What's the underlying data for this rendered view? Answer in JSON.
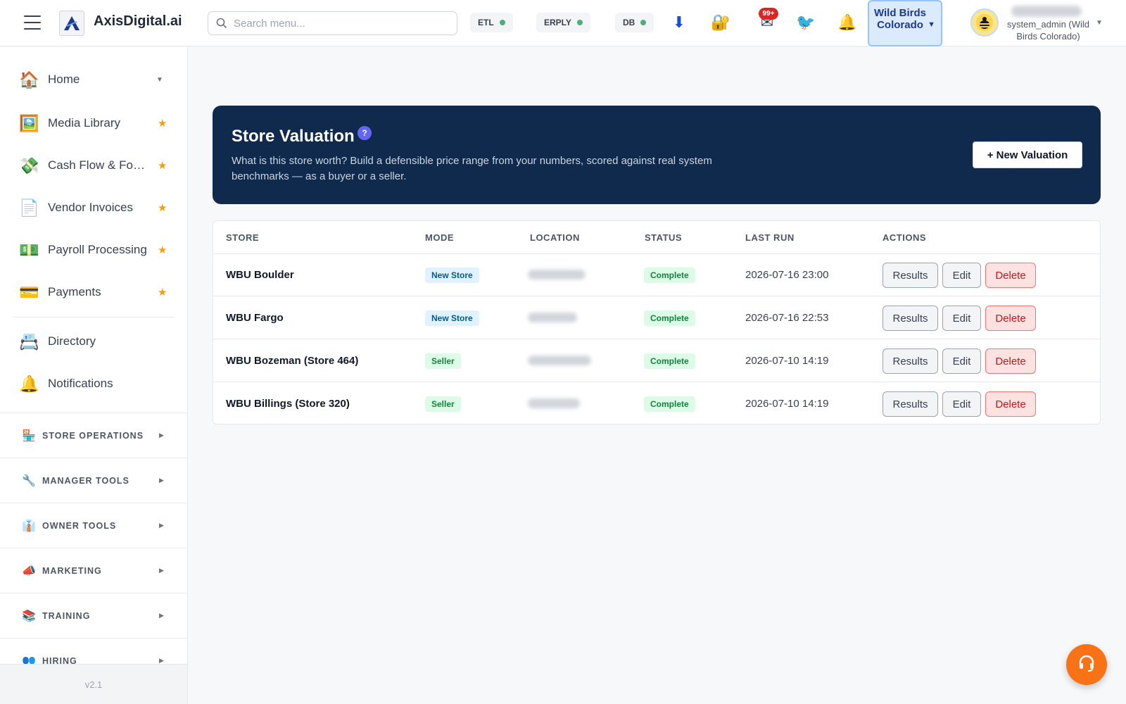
{
  "header": {
    "brand": "AxisDigital.ai",
    "search_placeholder": "Search menu...",
    "status_pills": [
      {
        "label": "ETL",
        "status_color": "#4caf7a"
      },
      {
        "label": "ERPLY",
        "status_color": "#4caf7a"
      },
      {
        "label": "DB",
        "status_color": "#4caf7a"
      }
    ],
    "icons": {
      "download": "⬇",
      "lock": "🔐",
      "mail": "✉",
      "bird": "🐦",
      "bell": "🔔"
    },
    "mail_badge": "99+",
    "store_switcher": {
      "label": "Wild Birds Colorado"
    },
    "user": {
      "role": "system_admin (Wild Birds Colorado)"
    }
  },
  "sidebar": {
    "items": [
      {
        "icon": "🏠",
        "label": "Home"
      },
      {
        "icon": "🖼️",
        "label": "Media Library"
      },
      {
        "icon": "💸",
        "label": "Cash Flow & Forecast"
      },
      {
        "icon": "📄",
        "label": "Vendor Invoices"
      },
      {
        "icon": "💵",
        "label": "Payroll Processing"
      },
      {
        "icon": "💳",
        "label": "Payments"
      },
      {
        "icon": "📇",
        "label": "Directory"
      },
      {
        "icon": "🔔",
        "label": "Notifications"
      }
    ],
    "sections": [
      {
        "icon": "🏪",
        "label": "STORE OPERATIONS"
      },
      {
        "icon": "🔧",
        "label": "MANAGER TOOLS"
      },
      {
        "icon": "👔",
        "label": "OWNER TOOLS"
      },
      {
        "icon": "📣",
        "label": "MARKETING"
      },
      {
        "icon": "📚",
        "label": "TRAINING"
      },
      {
        "icon": "👥",
        "label": "HIRING"
      }
    ],
    "version": "v2.1"
  },
  "hero": {
    "title": "Store Valuation",
    "help": "?",
    "description": "What is this store worth? Build a defensible price range from your numbers, scored against real system benchmarks — as a buyer or a seller.",
    "new_button": "+ New Valuation"
  },
  "table": {
    "columns": [
      "STORE",
      "MODE",
      "LOCATION",
      "STATUS",
      "LAST RUN",
      "ACTIONS"
    ],
    "rows": [
      {
        "store": "WBU Boulder",
        "mode": "New Store",
        "status": "Complete",
        "last_run": "2026-07-16 23:00"
      },
      {
        "store": "WBU Fargo",
        "mode": "New Store",
        "status": "Complete",
        "last_run": "2026-07-16 22:53"
      },
      {
        "store": "WBU Bozeman (Store 464)",
        "mode": "Seller",
        "status": "Complete",
        "last_run": "2026-07-10 14:19"
      },
      {
        "store": "WBU Billings (Store 320)",
        "mode": "Seller",
        "status": "Complete",
        "last_run": "2026-07-10 14:19"
      }
    ],
    "actions": {
      "results": "Results",
      "edit": "Edit",
      "delete": "Delete"
    }
  }
}
